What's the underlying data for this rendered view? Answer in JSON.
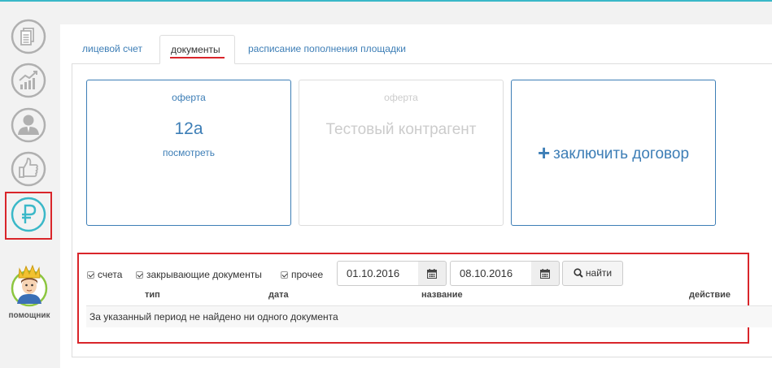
{
  "colors": {
    "accent": "#3d7eb6",
    "highlight": "#d9252a",
    "rail_icon": "#b0b0b0",
    "rail_icon_active": "#3ab8c8",
    "top_line": "#3ab8c8"
  },
  "sidebar": {
    "items": [
      {
        "icon": "documents-icon"
      },
      {
        "icon": "chart-growth-icon"
      },
      {
        "icon": "user-icon"
      },
      {
        "icon": "thumbs-up-icon"
      },
      {
        "icon": "ruble-icon",
        "active": true
      }
    ],
    "helper": {
      "label": "помощник",
      "icon": "helper-avatar-icon"
    }
  },
  "tabs": [
    {
      "label": "лицевой счет"
    },
    {
      "label": "документы",
      "active": true
    },
    {
      "label": "расписание пополнения площадки"
    }
  ],
  "cards": {
    "offer1": {
      "subtitle": "оферта",
      "number": "12а",
      "link": "посмотреть"
    },
    "offer2": {
      "subtitle": "оферта",
      "name": "Тестовый контрагент"
    },
    "new_contract": {
      "icon": "plus-icon",
      "label": "заключить договор"
    }
  },
  "filters": {
    "checkboxes": [
      {
        "label": "счета",
        "checked": true
      },
      {
        "label": "закрывающие документы",
        "checked": true
      },
      {
        "label": "прочее",
        "checked": true
      }
    ],
    "date_from": "01.10.2016",
    "date_to": "08.10.2016",
    "calendar_icon": "calendar-icon",
    "find_label": "найти",
    "find_icon": "search-icon"
  },
  "table": {
    "columns": [
      "тип",
      "дата",
      "название",
      "действие"
    ],
    "empty_message": "За указанный период не найдено ни одного документа"
  }
}
